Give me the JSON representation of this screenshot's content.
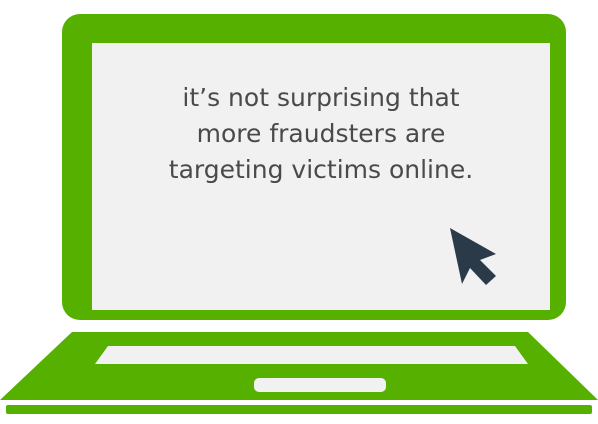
{
  "screen": {
    "message_lines": [
      "it’s not surprising that",
      "more fraudsters are",
      "targeting victims online."
    ]
  },
  "icons": {
    "cursor": "mouse-pointer-arrow-icon"
  },
  "colors": {
    "laptop_green": "#55b000",
    "screen_background": "#f1f1f1",
    "text": "#4a4a4a",
    "cursor": "#2b3a48"
  }
}
